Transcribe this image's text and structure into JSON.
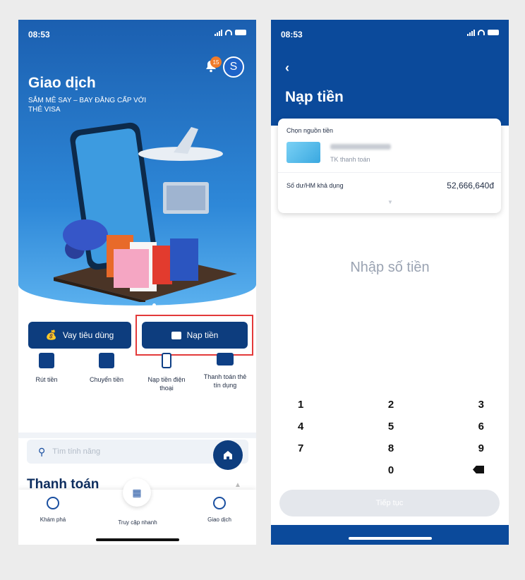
{
  "status": {
    "time": "08:53"
  },
  "left": {
    "hero": {
      "title": "Giao dịch",
      "subtitle": "SẮM MÊ SAY – BAY ĐẲNG CẤP VỚI THẺ VISA",
      "notification_count": "15",
      "avatar_letter": "S"
    },
    "buttons": {
      "loan": "Vay tiêu dùng",
      "deposit": "Nạp tiền"
    },
    "services": [
      {
        "label": "Rút tiền",
        "icon": "atm-icon"
      },
      {
        "label": "Chuyển tiền",
        "icon": "transfer-icon"
      },
      {
        "label": "Nạp tiền điện thoại",
        "icon": "phone-topup-icon"
      },
      {
        "label": "Thanh toán thẻ tín dụng",
        "icon": "credit-card-icon"
      }
    ],
    "search": {
      "placeholder": "Tìm tính năng"
    },
    "section_title": "Thanh toán",
    "tabs": [
      {
        "label": "Khám phá",
        "icon": "compass-icon"
      },
      {
        "label": "Truy cập nhanh",
        "icon": "scan-icon"
      },
      {
        "label": "Giao dịch",
        "icon": "exchange-icon"
      }
    ]
  },
  "right": {
    "title": "Nạp tiền",
    "source_label": "Chọn nguồn tiền",
    "account_type": "TK thanh toán",
    "balance_label": "Số dư/HM khả dụng",
    "balance_value": "52,666,640đ",
    "amount_placeholder": "Nhập số tiền",
    "keypad": [
      [
        "1",
        "2",
        "3"
      ],
      [
        "4",
        "5",
        "6"
      ],
      [
        "7",
        "8",
        "9"
      ],
      [
        "",
        "0",
        "backspace"
      ]
    ],
    "continue_label": "Tiếp tục"
  },
  "colors": {
    "primary": "#0b4a9b",
    "highlight_border": "#e33a3a",
    "badge": "#f07b2a"
  }
}
